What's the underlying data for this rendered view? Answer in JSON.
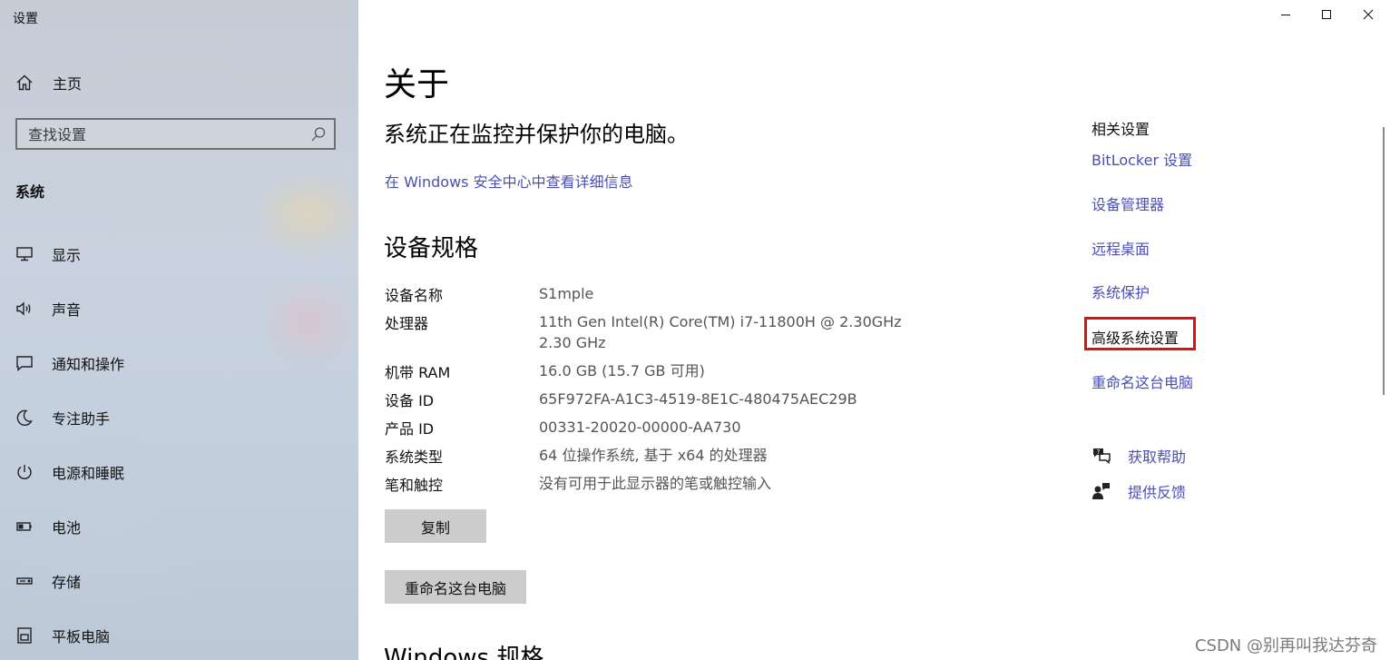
{
  "window": {
    "app_title": "设置",
    "controls": [
      "minimize",
      "maximize",
      "close"
    ]
  },
  "sidebar": {
    "home_label": "主页",
    "search_placeholder": "查找设置",
    "section_title": "系统",
    "items": [
      {
        "label": "显示",
        "icon": "display-icon"
      },
      {
        "label": "声音",
        "icon": "sound-icon"
      },
      {
        "label": "通知和操作",
        "icon": "notifications-icon"
      },
      {
        "label": "专注助手",
        "icon": "focus-assist-icon"
      },
      {
        "label": "电源和睡眠",
        "icon": "power-icon"
      },
      {
        "label": "电池",
        "icon": "battery-icon"
      },
      {
        "label": "存储",
        "icon": "storage-icon"
      },
      {
        "label": "平板电脑",
        "icon": "tablet-icon"
      }
    ]
  },
  "main": {
    "title": "关于",
    "protect_text": "系统正在监控并保护你的电脑。",
    "security_link": "在 Windows 安全中心中查看详细信息",
    "device_specs_title": "设备规格",
    "specs": [
      {
        "label": "设备名称",
        "value": "S1mple"
      },
      {
        "label": "处理器",
        "value": "11th Gen Intel(R) Core(TM) i7-11800H @ 2.30GHz",
        "value2": "2.30 GHz"
      },
      {
        "label": "机带 RAM",
        "value": "16.0 GB (15.7 GB 可用)"
      },
      {
        "label": "设备 ID",
        "value": "65F972FA-A1C3-4519-8E1C-480475AEC29B"
      },
      {
        "label": "产品 ID",
        "value": "00331-20020-00000-AA730"
      },
      {
        "label": "系统类型",
        "value": "64 位操作系统, 基于 x64 的处理器"
      },
      {
        "label": "笔和触控",
        "value": "没有可用于此显示器的笔或触控输入"
      }
    ],
    "copy_button": "复制",
    "rename_button": "重命名这台电脑",
    "windows_specs_title": "Windows 规格"
  },
  "related": {
    "title": "相关设置",
    "links": [
      "BitLocker 设置",
      "设备管理器",
      "远程桌面",
      "系统保护",
      "高级系统设置",
      "重命名这台电脑"
    ],
    "help_label": "获取帮助",
    "feedback_label": "提供反馈"
  },
  "watermark": "CSDN @别再叫我达芬奇",
  "colors": {
    "link": "#4a4fb5",
    "highlight": "#e01010",
    "button_bg": "#cccccc"
  }
}
